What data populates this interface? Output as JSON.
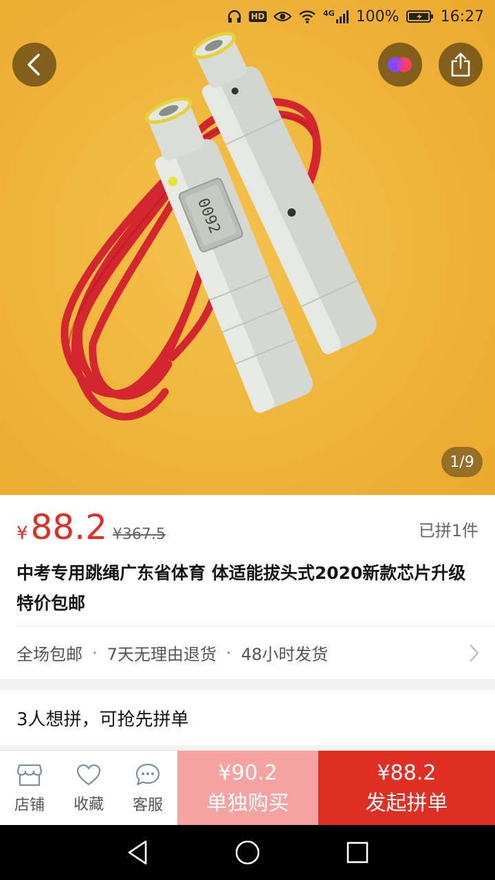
{
  "status_bar": {
    "battery": "100%",
    "time": "16:27",
    "hd_label": "HD",
    "network": "4G",
    "icons": [
      "headphones-icon",
      "hd-icon",
      "eye-icon",
      "wifi-icon",
      "signal-icon",
      "battery-icon"
    ]
  },
  "gallery": {
    "page_indicator": "1/9",
    "current_page": 1,
    "total_pages": 9,
    "counter_display": "0092"
  },
  "product": {
    "currency_symbol": "¥",
    "price": "88.2",
    "original_price": "¥367.5",
    "sold_count": "已拼1件",
    "title": "中考专用跳绳广东省体育 体适能拔头式2020新款芯片升级 特价包邮"
  },
  "services": {
    "items": [
      "全场包邮",
      "7天无理由退货",
      "48小时发货"
    ],
    "separator": "·"
  },
  "group_tip": "3人想拼，可抢先拼单",
  "bottom_bar": {
    "store_label": "店铺",
    "favorite_label": "收藏",
    "service_label": "客服",
    "solo_price": "¥90.2",
    "solo_label": "单独购买",
    "group_price": "¥88.2",
    "group_label": "发起拼单"
  },
  "colors": {
    "accent": "#e02e24",
    "solo_button": "#f4a3a0",
    "image_background": "#f0b93a"
  }
}
